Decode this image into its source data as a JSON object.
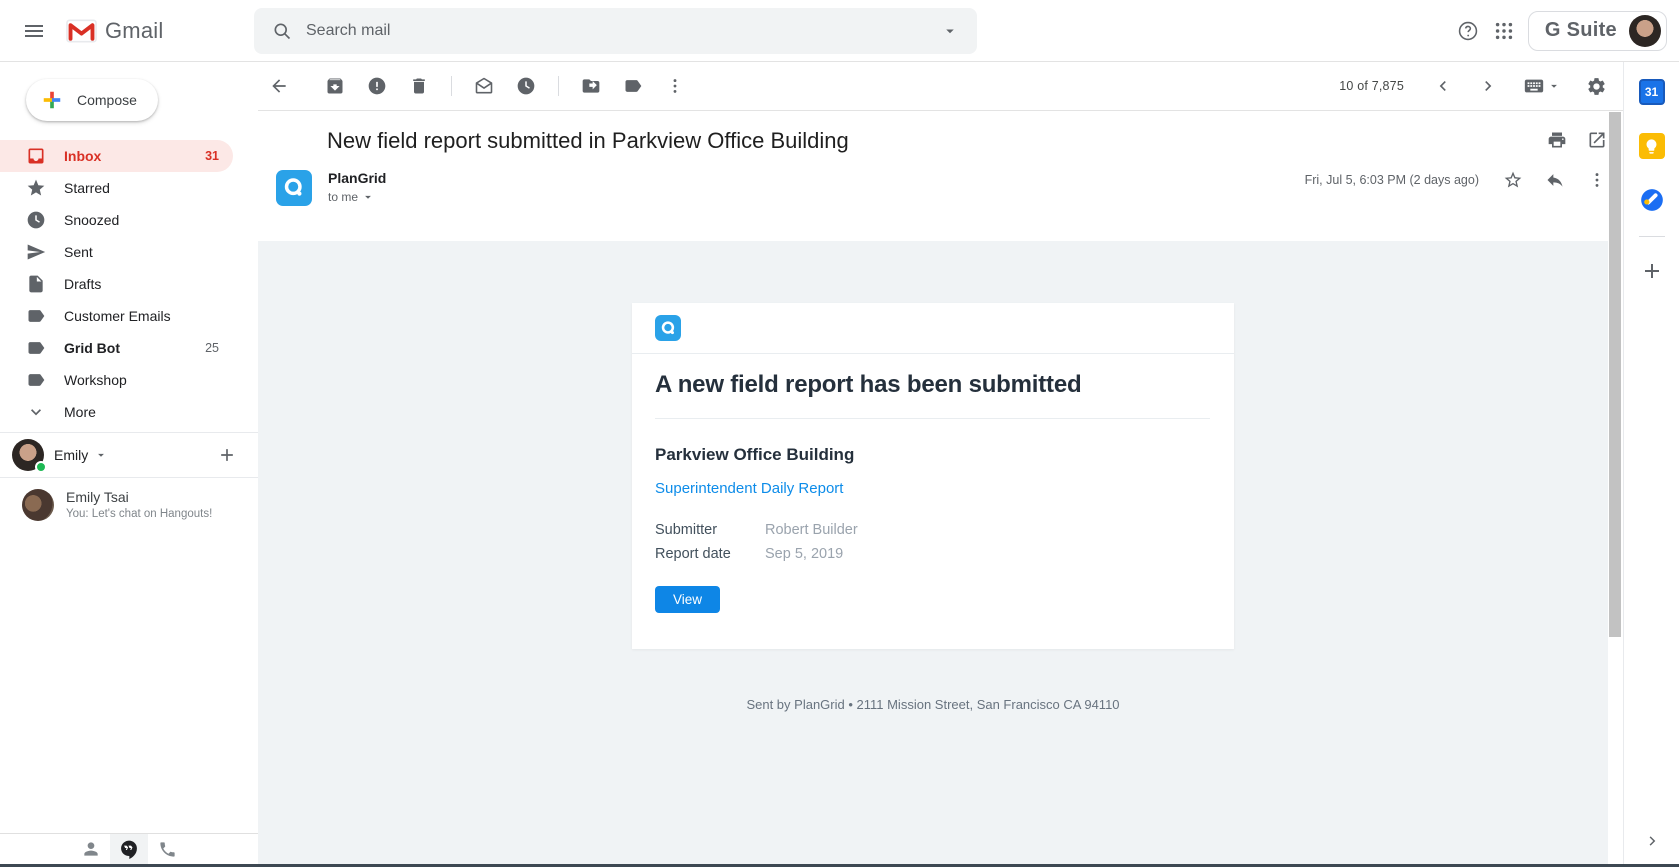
{
  "topbar": {
    "app_name": "Gmail",
    "search_placeholder": "Search mail",
    "account_label": "G Suite"
  },
  "toolbar": {
    "pagination": "10 of 7,875"
  },
  "sidebar": {
    "compose_label": "Compose",
    "items": [
      {
        "label": "Inbox",
        "count": "31"
      },
      {
        "label": "Starred"
      },
      {
        "label": "Snoozed"
      },
      {
        "label": "Sent"
      },
      {
        "label": "Drafts"
      },
      {
        "label": "Customer Emails"
      },
      {
        "label": "Grid Bot",
        "count": "25"
      },
      {
        "label": "Workshop"
      },
      {
        "label": "More"
      }
    ],
    "profile": {
      "name": "Emily"
    },
    "hangouts": {
      "contact_name": "Emily Tsai",
      "message_preview": "You: Let's chat on Hangouts!"
    }
  },
  "email": {
    "subject": "New field report submitted in Parkview Office Building",
    "sender_name": "PlanGrid",
    "recipient": "to me",
    "date": "Fri, Jul 5, 6:03 PM (2 days ago)",
    "card": {
      "heading": "A new field report has been submitted",
      "project_name": "Parkview Office Building",
      "report_link": "Superintendent Daily Report",
      "fields": [
        {
          "label": "Submitter",
          "value": "Robert Builder"
        },
        {
          "label": "Report date",
          "value": "Sep 5, 2019"
        }
      ],
      "view_button_label": "View"
    },
    "footer_text": "Sent by PlanGrid • 2111 Mission Street, San Francisco CA 94110"
  },
  "right_panel": {
    "calendar_day": "31"
  },
  "colors": {
    "gmail_red": "#d93025",
    "inbox_active_bg": "#fce8e6",
    "plangrid_blue": "#2aa2e8",
    "button_blue": "#0e86e6",
    "link_blue": "#0d8ce9",
    "body_gray": "#f0f3f5"
  }
}
